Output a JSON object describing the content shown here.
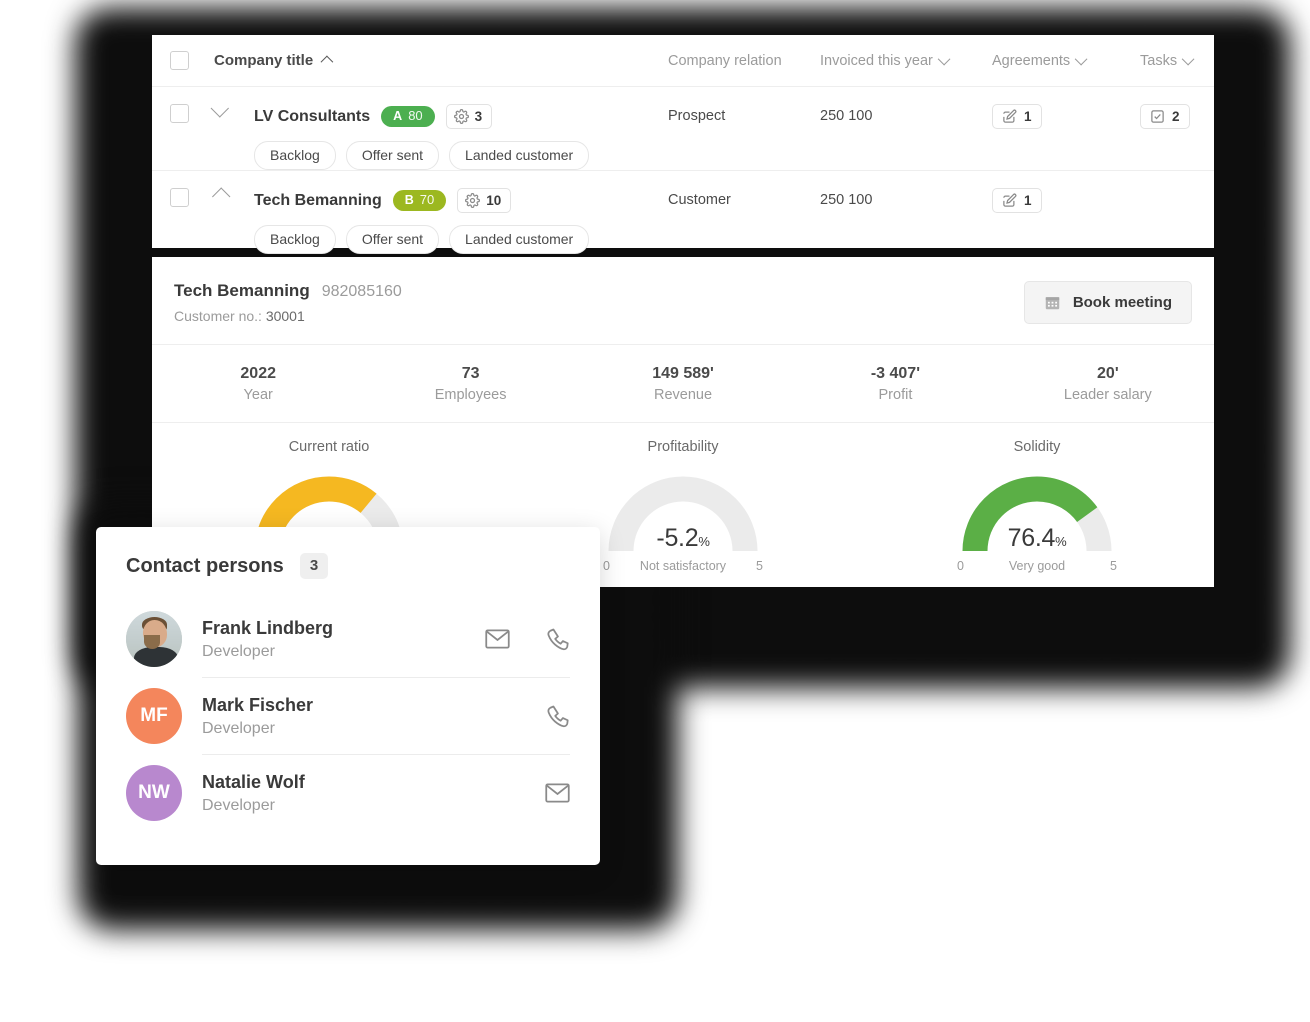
{
  "table": {
    "columns": [
      {
        "label": "Company title",
        "sort": "asc",
        "has_caret": true
      },
      {
        "label": "Company relation",
        "has_caret": false
      },
      {
        "label": "Invoiced this year",
        "has_caret": true
      },
      {
        "label": "Agreements",
        "has_caret": true
      },
      {
        "label": "Tasks",
        "has_caret": true
      }
    ],
    "rows": [
      {
        "name": "LV Consultants",
        "expanded": false,
        "grade_letter": "A",
        "grade_score": "80",
        "grade_color": "#4CAF50",
        "settings_count": "3",
        "tags": [
          "Backlog",
          "Offer sent",
          "Landed customer"
        ],
        "relation": "Prospect",
        "invoiced": "250 100",
        "agreements": "1",
        "tasks": "2"
      },
      {
        "name": "Tech Bemanning",
        "expanded": true,
        "grade_letter": "B",
        "grade_score": "70",
        "grade_color": "#9CB820",
        "settings_count": "10",
        "tags": [
          "Backlog",
          "Offer sent",
          "Landed customer"
        ],
        "relation": "Customer",
        "invoiced": "250 100",
        "agreements": "1",
        "tasks": ""
      }
    ]
  },
  "detail": {
    "title": "Tech Bemanning",
    "org_number": "982085160",
    "customer_no_label": "Customer no.:",
    "customer_no": "30001",
    "book_meeting_label": "Book meeting",
    "stats": [
      {
        "value": "2022",
        "label": "Year"
      },
      {
        "value": "73",
        "label": "Employees"
      },
      {
        "value": "149 589'",
        "label": "Revenue"
      },
      {
        "value": "-3 407'",
        "label": "Profit"
      },
      {
        "value": "20'",
        "label": "Leader salary"
      }
    ],
    "gauges": [
      {
        "title": "Current ratio",
        "value": "",
        "unit": "",
        "rating": "",
        "min": "0",
        "max": "5",
        "fill_pct": 72,
        "color": "#F5B821"
      },
      {
        "title": "Profitability",
        "value": "-5.2",
        "unit": "%",
        "rating": "Not satisfactory",
        "min": "0",
        "max": "5",
        "fill_pct": 0,
        "color": "#E8A33D"
      },
      {
        "title": "Solidity",
        "value": "76.4",
        "unit": "%",
        "rating": "Very good",
        "min": "0",
        "max": "5",
        "fill_pct": 80,
        "color": "#5BAF46"
      }
    ]
  },
  "contacts": {
    "title": "Contact persons",
    "count": "3",
    "people": [
      {
        "name": "Frank Lindberg",
        "role": "Developer",
        "avatar_type": "photo",
        "initials": "",
        "avatar_color": "",
        "actions": [
          "mail-icon",
          "phone-icon"
        ]
      },
      {
        "name": "Mark Fischer",
        "role": "Developer",
        "avatar_type": "initials",
        "initials": "MF",
        "avatar_color": "#F4865C",
        "actions": [
          "phone-icon"
        ]
      },
      {
        "name": "Natalie Wolf",
        "role": "Developer",
        "avatar_type": "initials",
        "initials": "NW",
        "avatar_color": "#B888CE",
        "actions": [
          "mail-icon"
        ]
      }
    ]
  }
}
